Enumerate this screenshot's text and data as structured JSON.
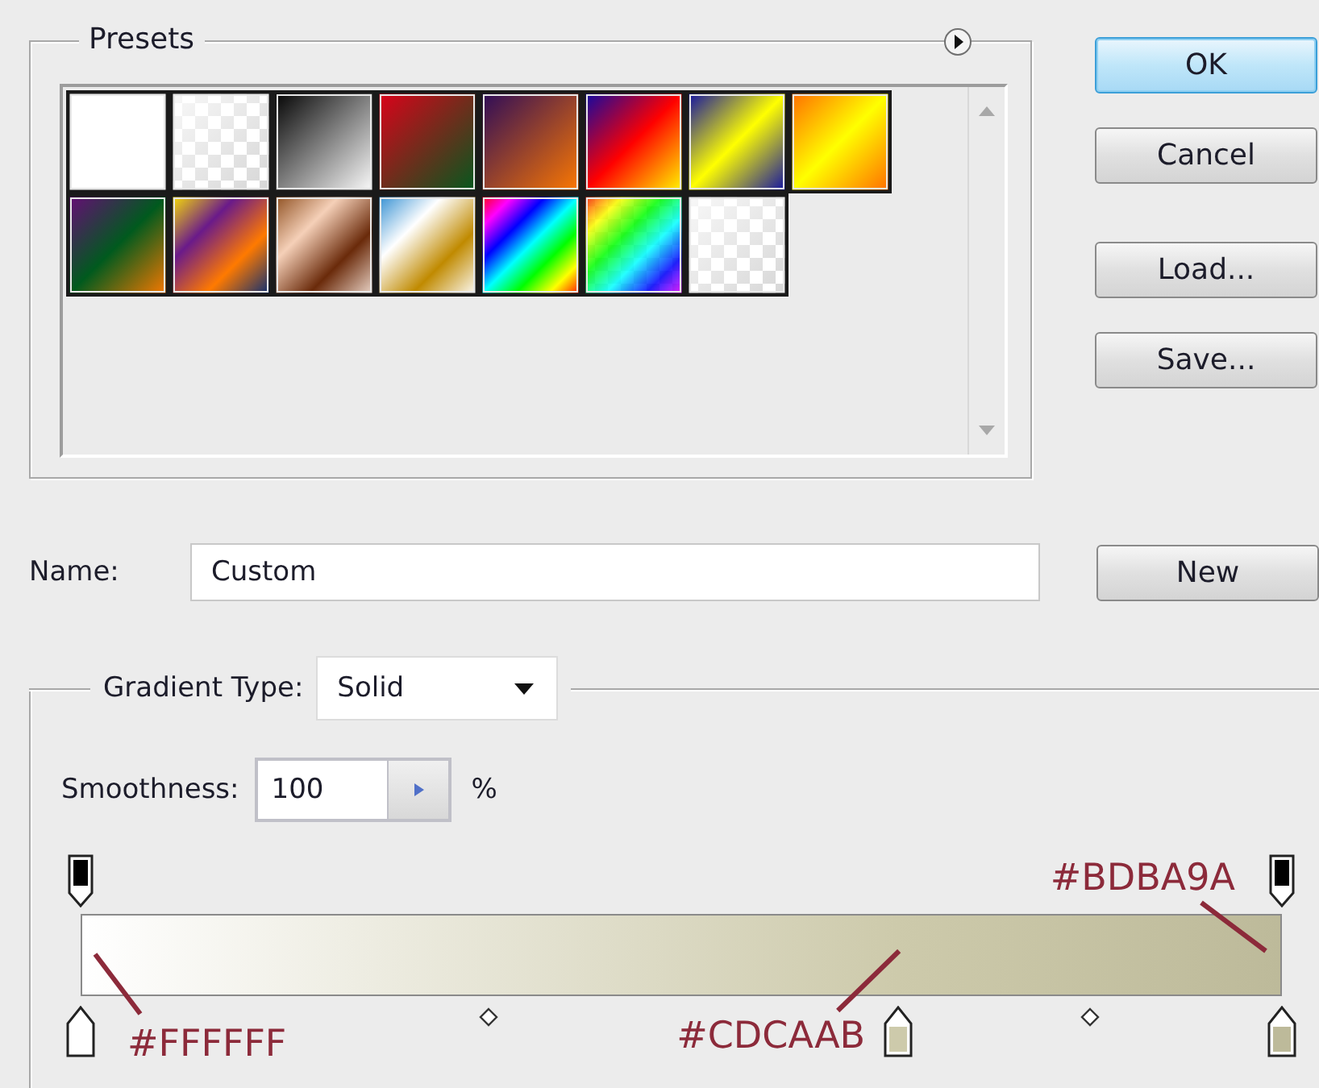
{
  "presets": {
    "title": "Presets",
    "swatches": [
      {
        "kind": "opaque"
      },
      {
        "kind": "transparent"
      },
      {
        "kind": "opaque"
      },
      {
        "kind": "opaque"
      },
      {
        "kind": "opaque"
      },
      {
        "kind": "opaque"
      },
      {
        "kind": "opaque"
      },
      {
        "kind": "opaque"
      },
      {
        "kind": "opaque"
      },
      {
        "kind": "opaque"
      },
      {
        "kind": "opaque"
      },
      {
        "kind": "opaque"
      },
      {
        "kind": "opaque"
      },
      {
        "kind": "transparent"
      },
      {
        "kind": "transparent"
      }
    ]
  },
  "buttons": [
    {
      "label": "OK",
      "kind": "default"
    },
    {
      "label": "Cancel",
      "kind": "normal"
    },
    {
      "label": "Load...",
      "kind": "normal"
    },
    {
      "label": "Save...",
      "kind": "normal"
    }
  ],
  "name": {
    "label": "Name:",
    "value": "Custom",
    "button": "New"
  },
  "gradient": {
    "type_label": "Gradient Type:",
    "type_value": "Solid",
    "smoothness_label": "Smoothness:",
    "smoothness_value": "100",
    "smoothness_unit": "%",
    "opacity_stops": [
      {
        "level": 0
      },
      {
        "level": 1
      }
    ],
    "color_stops": [
      {
        "level": 0,
        "color": "#ffffff",
        "annotation": "#FFFFFF"
      },
      {
        "level": 0.68,
        "color": "#cdcaab",
        "annotation": "#CDCAAB"
      },
      {
        "level": 1,
        "color": "#bdba9a",
        "annotation": "#BDBA9A"
      }
    ],
    "midpoints": [
      {
        "level": 0.34
      },
      {
        "level": 0.84
      }
    ]
  }
}
